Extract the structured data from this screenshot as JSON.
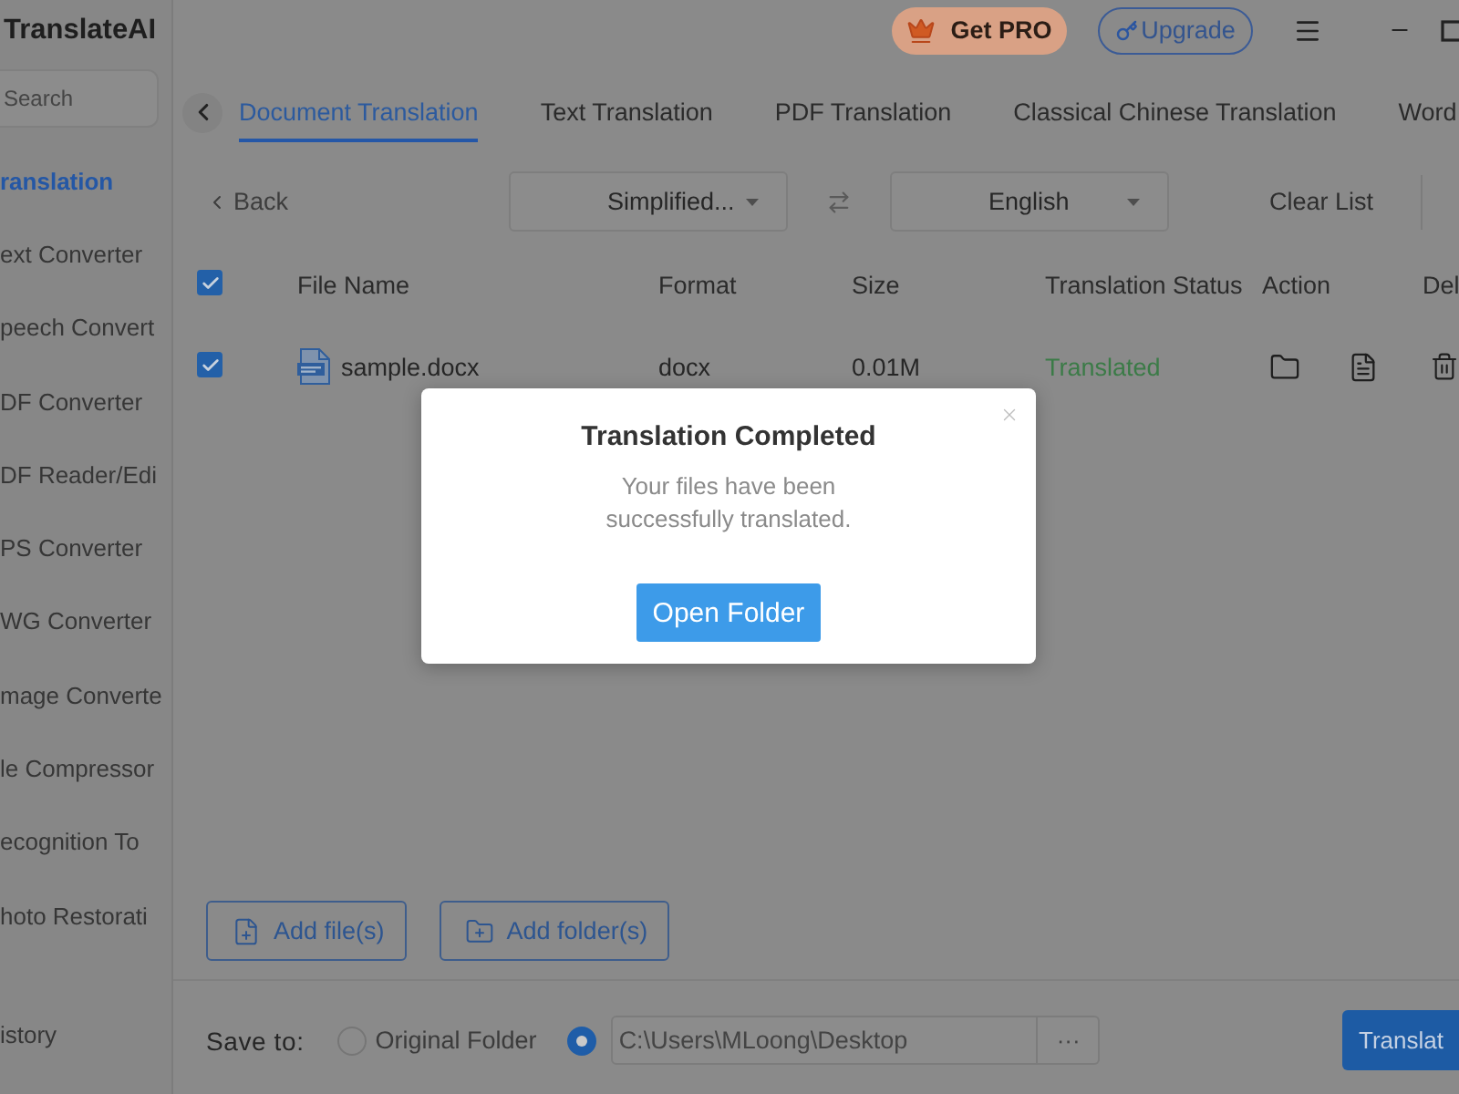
{
  "app": {
    "title": "TranslateAI"
  },
  "top_bar": {
    "buttons": [
      {
        "kind": "pro",
        "label": "Get PRO"
      },
      {
        "kind": "upgrade",
        "label": "Upgrade"
      }
    ]
  },
  "sidebar": {
    "search": {
      "placeholder": "Search"
    },
    "items": [
      {
        "label": "ranslation",
        "selected": true
      },
      {
        "label": "ext Converter",
        "selected": false
      },
      {
        "label": "peech Convert",
        "selected": false
      },
      {
        "label": "DF Converter",
        "selected": false
      },
      {
        "label": "DF Reader/Edi",
        "selected": false
      },
      {
        "label": "PS Converter",
        "selected": false
      },
      {
        "label": "WG Converter",
        "selected": false
      },
      {
        "label": "mage Converte",
        "selected": false
      },
      {
        "label": "le Compressor",
        "selected": false
      },
      {
        "label": "ecognition To",
        "selected": false
      },
      {
        "label": "hoto Restorati",
        "selected": false
      }
    ],
    "footer_item": "istory"
  },
  "tabs": [
    {
      "label": "Document Translation",
      "selected": true
    },
    {
      "label": "Text Translation",
      "selected": false
    },
    {
      "label": "PDF Translation",
      "selected": false
    },
    {
      "label": "Classical Chinese Translation",
      "selected": false
    },
    {
      "label": "Word",
      "selected": false
    }
  ],
  "toolbar": {
    "back": "Back",
    "source_language": "Simplified...",
    "target_language": "English",
    "clear_button": "Clear List"
  },
  "table": {
    "select_all": {
      "checked": true
    },
    "columns": [
      "File Name",
      "Format",
      "Size",
      "Translation Status",
      "Action",
      "Del"
    ],
    "rows": [
      {
        "checked": true,
        "file_name": "sample.docx",
        "format": "docx",
        "size": "0.01M",
        "status": "Translated"
      }
    ]
  },
  "add_buttons": [
    {
      "kind": "file",
      "label": "Add file(s)"
    },
    {
      "kind": "folder",
      "label": "Add folder(s)"
    }
  ],
  "save_to": {
    "label": "Save to:",
    "original_folder": {
      "label": "Original Folder",
      "selected": false
    },
    "custom_folder": {
      "path": "C:\\Users\\MLoong\\Desktop",
      "selected": true
    },
    "browse_button": "···"
  },
  "translate_button": "Translat",
  "dialog": {
    "title": "Translation Completed",
    "message": "Your files have been successfully translated.",
    "button": "Open Folder"
  }
}
